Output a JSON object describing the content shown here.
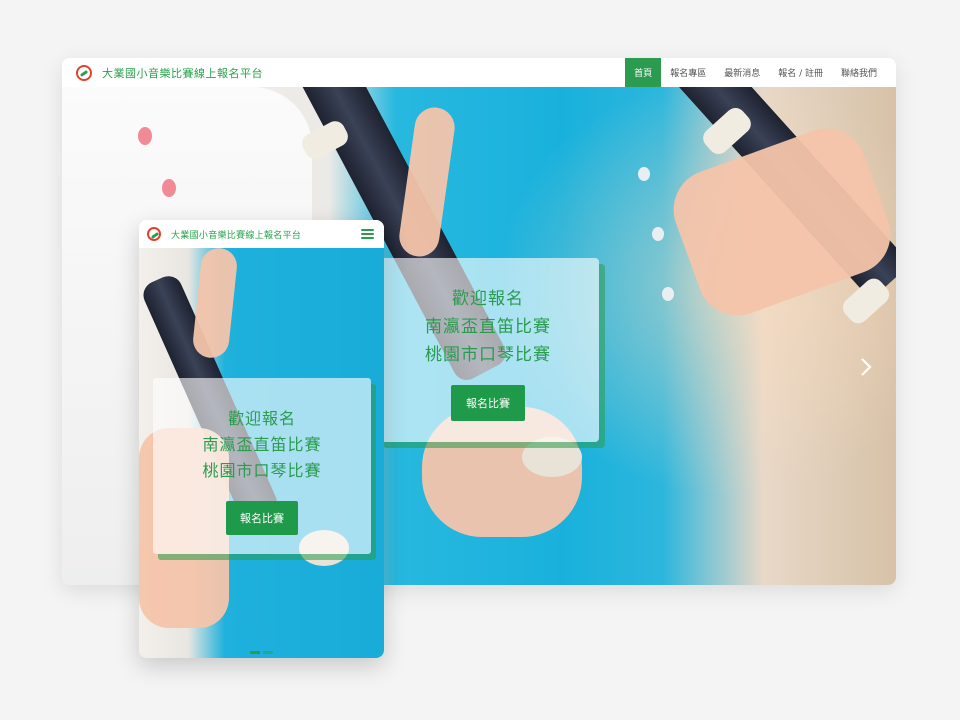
{
  "brand": {
    "name": "大業國小音樂比賽線上報名平台"
  },
  "desktop": {
    "menu": [
      {
        "label": "首頁",
        "active": true
      },
      {
        "label": "報名專區",
        "active": false
      },
      {
        "label": "最新消息",
        "active": false
      },
      {
        "label": "報名 / 註冊",
        "active": false
      },
      {
        "label": "聯絡我們",
        "active": false
      }
    ],
    "hero": {
      "line1": "歡迎報名",
      "line2": "南瀛盃直笛比賽",
      "line3": "桃園市口琴比賽",
      "cta": "報名比賽",
      "next_icon": "chevron-right-icon"
    }
  },
  "mobile": {
    "menu_icon": "hamburger-icon",
    "hero": {
      "line1": "歡迎報名",
      "line2": "南瀛盃直笛比賽",
      "line3": "桃園市口琴比賽",
      "cta": "報名比賽"
    },
    "indicators": {
      "count": 2,
      "active_index": 0
    }
  },
  "colors": {
    "accent": "#2a9b4f",
    "logo_ring": "#e2412e",
    "hero_blue": "#1fb0d8"
  }
}
